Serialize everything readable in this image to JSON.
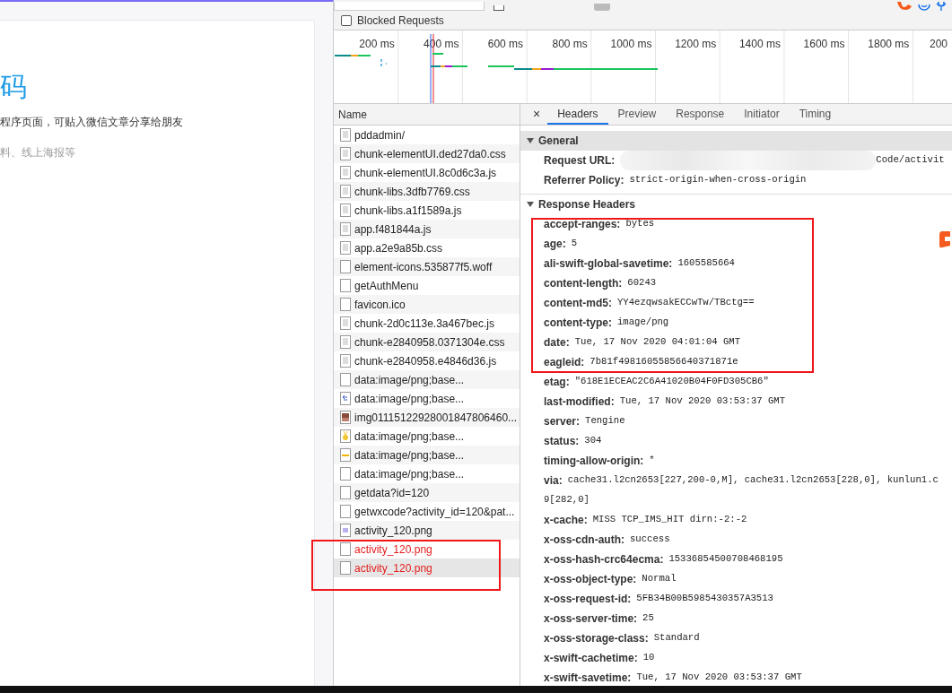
{
  "page": {
    "heading": "码",
    "line_1": "程序页面，可贴入微信文章分享给朋友",
    "line_2": "料、线上海报等"
  },
  "filter_bar": {
    "hide_data_urls": {
      "checked": false
    },
    "types": [
      {
        "selected": true
      }
    ]
  },
  "blocked_requests": {
    "label": "Blocked Requests",
    "checked": false
  },
  "timeline": {
    "ticks": [
      "200 ms",
      "400 ms",
      "600 ms",
      "800 ms",
      "1000 ms",
      "1200 ms",
      "1400 ms",
      "1600 ms",
      "1800 ms",
      "200"
    ]
  },
  "requests": {
    "column": "Name",
    "rows": [
      {
        "name": "pddadmin/",
        "kind": "doc",
        "failed": false,
        "selected": false
      },
      {
        "name": "chunk-elementUI.ded27da0.css",
        "kind": "doc",
        "failed": false,
        "selected": false
      },
      {
        "name": "chunk-elementUI.8c0d6c3a.js",
        "kind": "doc",
        "failed": false,
        "selected": false
      },
      {
        "name": "chunk-libs.3dfb7769.css",
        "kind": "doc",
        "failed": false,
        "selected": false
      },
      {
        "name": "chunk-libs.a1f1589a.js",
        "kind": "doc",
        "failed": false,
        "selected": false
      },
      {
        "name": "app.f481844a.js",
        "kind": "doc",
        "failed": false,
        "selected": false
      },
      {
        "name": "app.a2e9a85b.css",
        "kind": "doc",
        "failed": false,
        "selected": false
      },
      {
        "name": "element-icons.535877f5.woff",
        "kind": "blank",
        "failed": false,
        "selected": false
      },
      {
        "name": "getAuthMenu",
        "kind": "blank",
        "failed": false,
        "selected": false
      },
      {
        "name": "favicon.ico",
        "kind": "blank",
        "failed": false,
        "selected": false
      },
      {
        "name": "chunk-2d0c113e.3a467bec.js",
        "kind": "doc",
        "failed": false,
        "selected": false
      },
      {
        "name": "chunk-e2840958.0371304e.css",
        "kind": "doc",
        "failed": false,
        "selected": false
      },
      {
        "name": "chunk-e2840958.e4846d36.js",
        "kind": "doc",
        "failed": false,
        "selected": false
      },
      {
        "name": "data:image/png;base...",
        "kind": "blank",
        "failed": false,
        "selected": false
      },
      {
        "name": "data:image/png;base...",
        "kind": "arrow",
        "failed": false,
        "selected": false
      },
      {
        "name": "img01115122928001847806460...",
        "kind": "photo",
        "failed": false,
        "selected": false
      },
      {
        "name": "data:image/png;base...",
        "kind": "medal",
        "failed": false,
        "selected": false
      },
      {
        "name": "data:image/png;base...",
        "kind": "dash",
        "failed": false,
        "selected": false
      },
      {
        "name": "data:image/png;base...",
        "kind": "blank",
        "failed": false,
        "selected": false
      },
      {
        "name": "getdata?id=120",
        "kind": "blank",
        "failed": false,
        "selected": false
      },
      {
        "name": "getwxcode?activity_id=120&pat...",
        "kind": "blank",
        "failed": false,
        "selected": false
      },
      {
        "name": "activity_120.png",
        "kind": "thumb",
        "failed": false,
        "selected": false
      },
      {
        "name": "activity_120.png",
        "kind": "blank",
        "failed": true,
        "selected": false
      },
      {
        "name": "activity_120.png",
        "kind": "blank",
        "failed": true,
        "selected": true
      }
    ]
  },
  "detail": {
    "close": "×",
    "tabs": [
      {
        "label": "Headers",
        "selected": true
      },
      {
        "label": "Preview",
        "selected": false
      },
      {
        "label": "Response",
        "selected": false
      },
      {
        "label": "Initiator",
        "selected": false
      },
      {
        "label": "Timing",
        "selected": false
      }
    ],
    "general": {
      "title": "General",
      "expanded": true,
      "fields": [
        {
          "key": "Request URL:",
          "value": "Code/activit",
          "redacted": true
        },
        {
          "key": "Referrer Policy:",
          "value": "strict-origin-when-cross-origin",
          "redacted": false
        }
      ]
    },
    "response_headers": {
      "title": "Response Headers",
      "expanded": true,
      "fields": [
        {
          "key": "accept-ranges:",
          "value": "bytes"
        },
        {
          "key": "age:",
          "value": "5"
        },
        {
          "key": "ali-swift-global-savetime:",
          "value": "1605585664"
        },
        {
          "key": "content-length:",
          "value": "60243"
        },
        {
          "key": "content-md5:",
          "value": "YY4ezqwsakECCwTw/TBctg=="
        },
        {
          "key": "content-type:",
          "value": "image/png"
        },
        {
          "key": "date:",
          "value": "Tue, 17 Nov 2020 04:01:04 GMT"
        },
        {
          "key": "eagleid:",
          "value": "7b81f49816055856640371871e"
        },
        {
          "key": "etag:",
          "value": "\"618E1ECEAC2C6A41020B04F0FD305CB6\""
        },
        {
          "key": "last-modified:",
          "value": "Tue, 17 Nov 2020 03:53:37 GMT"
        },
        {
          "key": "server:",
          "value": "Tengine"
        },
        {
          "key": "status:",
          "value": "304"
        },
        {
          "key": "timing-allow-origin:",
          "value": "*"
        },
        {
          "key": "via:",
          "value": "cache31.l2cn2653[227,200-0,M], cache31.l2cn2653[228,0], kunlun1.c"
        },
        {
          "value": "9[282,0]"
        },
        {
          "key": "x-cache:",
          "value": "MISS TCP_IMS_HIT dirn:-2:-2"
        },
        {
          "key": "x-oss-cdn-auth:",
          "value": "success"
        },
        {
          "key": "x-oss-hash-crc64ecma:",
          "value": "15336854500708468195"
        },
        {
          "key": "x-oss-object-type:",
          "value": "Normal"
        },
        {
          "key": "x-oss-request-id:",
          "value": "5FB34B00B5985430357A3513"
        },
        {
          "key": "x-oss-server-time:",
          "value": "25"
        },
        {
          "key": "x-oss-storage-class:",
          "value": "Standard"
        },
        {
          "key": "x-swift-cachetime:",
          "value": "10"
        },
        {
          "key": "x-swift-savetime:",
          "value": "Tue, 17 Nov 2020 03:53:37 GMT"
        }
      ]
    }
  }
}
